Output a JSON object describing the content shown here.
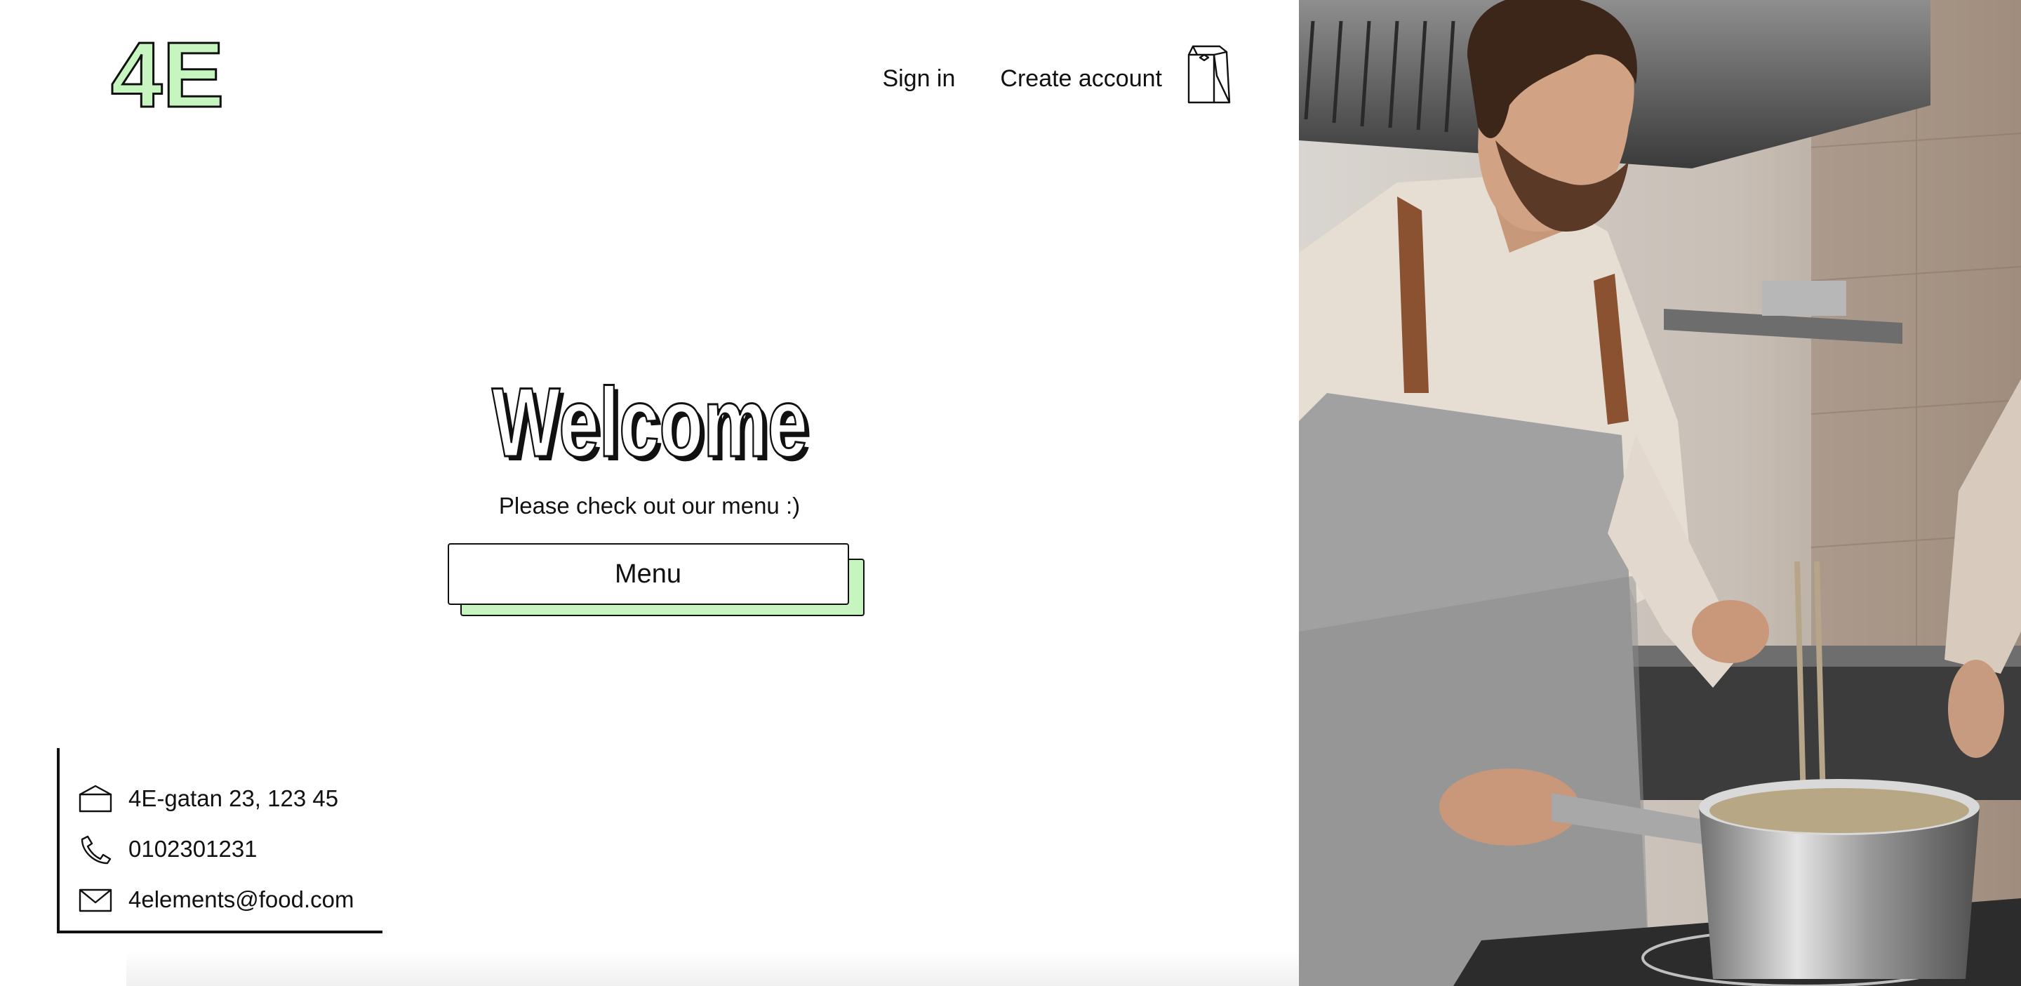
{
  "brand": {
    "logo_text": "4E",
    "accent": "#c6f5bf"
  },
  "nav": {
    "sign_in": "Sign in",
    "create_account": "Create account",
    "cart_icon": "shopping-bag-icon"
  },
  "hero": {
    "title": "Welcome",
    "subtitle": "Please check out our menu :)",
    "menu_button": "Menu"
  },
  "contact": {
    "address": "4E-gatan 23, 123 45",
    "phone": "0102301231",
    "email": "4elements@food.com",
    "icons": [
      "house-icon",
      "phone-icon",
      "mail-icon"
    ]
  }
}
